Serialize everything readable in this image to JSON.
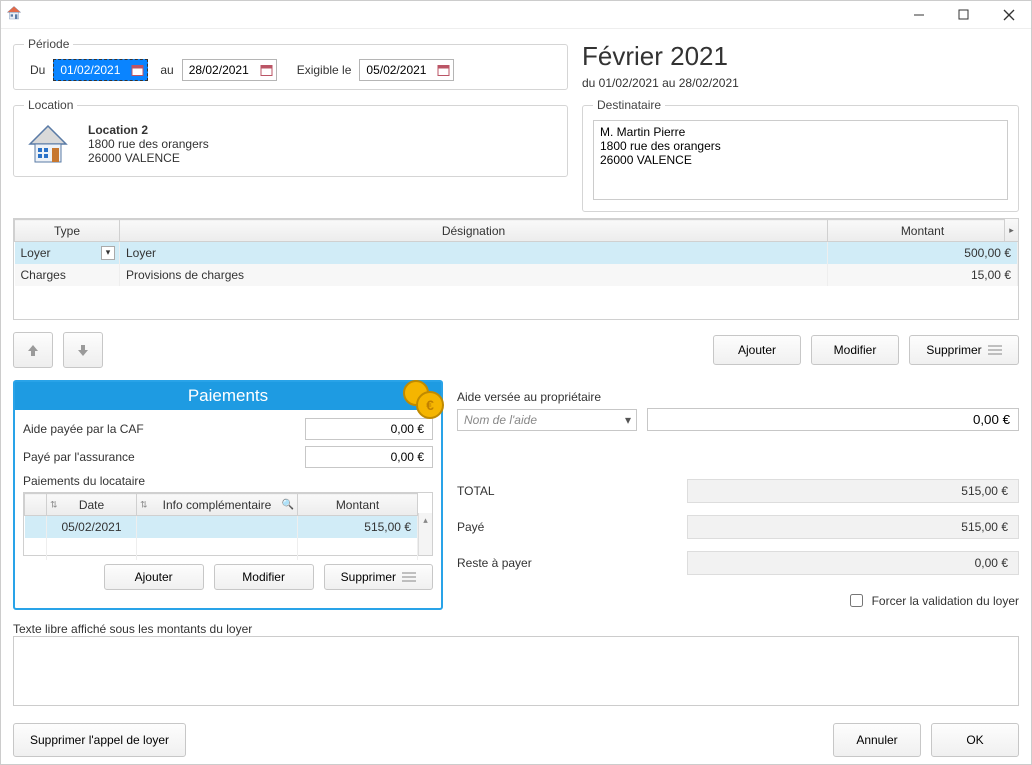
{
  "window": {},
  "period": {
    "legend": "Période",
    "from_label": "Du",
    "from_value": "01/02/2021",
    "to_label": "au",
    "to_value": "28/02/2021",
    "due_label": "Exigible le",
    "due_value": "05/02/2021"
  },
  "location": {
    "legend": "Location",
    "name": "Location 2",
    "addr1": "1800 rue des orangers",
    "addr2": "26000 VALENCE"
  },
  "heading": {
    "month": "Février 2021",
    "range": "du 01/02/2021 au 28/02/2021"
  },
  "recipient": {
    "legend": "Destinataire",
    "text": "M. Martin Pierre\n1800 rue des orangers\n26000 VALENCE"
  },
  "grid": {
    "headers": {
      "type": "Type",
      "designation": "Désignation",
      "amount": "Montant"
    },
    "rows": [
      {
        "type": "Loyer",
        "designation": "Loyer",
        "amount": "500,00 €"
      },
      {
        "type": "Charges",
        "designation": "Provisions de charges",
        "amount": "15,00 €"
      }
    ]
  },
  "grid_buttons": {
    "add": "Ajouter",
    "edit": "Modifier",
    "delete": "Supprimer"
  },
  "payments": {
    "title": "Paiements",
    "caf_label": "Aide payée par la CAF",
    "caf_value": "0,00 €",
    "ins_label": "Payé par l'assurance",
    "ins_value": "0,00 €",
    "subtitle": "Paiements du locataire",
    "headers": {
      "date": "Date",
      "info": "Info complémentaire",
      "amount": "Montant"
    },
    "rows": [
      {
        "date": "05/02/2021",
        "info": "",
        "amount": "515,00 €"
      }
    ],
    "add": "Ajouter",
    "edit": "Modifier",
    "delete": "Supprimer"
  },
  "totals": {
    "aide_label": "Aide versée au propriétaire",
    "aide_placeholder": "Nom de l'aide",
    "aide_amount": "0,00 €",
    "total_label": "TOTAL",
    "total_value": "515,00 €",
    "paid_label": "Payé",
    "paid_value": "515,00 €",
    "remain_label": "Reste à payer",
    "remain_value": "0,00 €",
    "force_label": "Forcer la validation du loyer"
  },
  "freetext": {
    "label": "Texte libre affiché sous les montants du loyer",
    "value": ""
  },
  "footer": {
    "delete_call": "Supprimer l'appel de loyer",
    "cancel": "Annuler",
    "ok": "OK"
  }
}
